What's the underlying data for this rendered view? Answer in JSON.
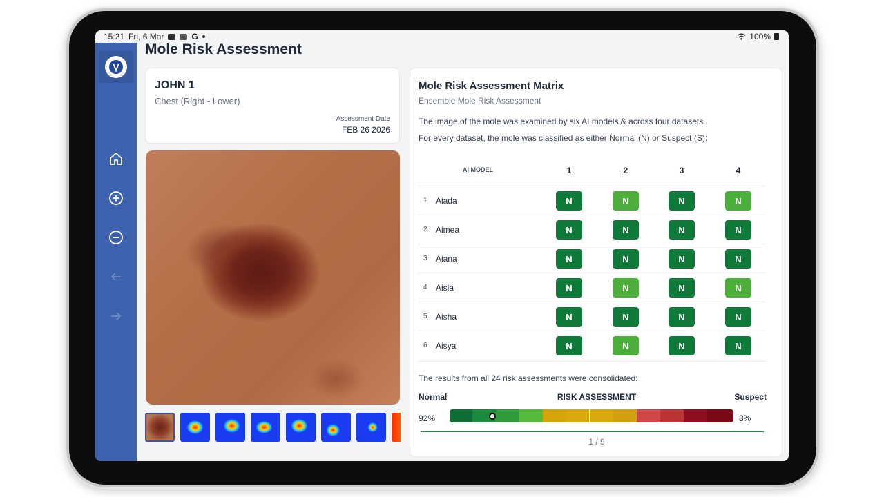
{
  "status": {
    "time": "15:21",
    "date": "Fri, 6 Mar",
    "battery": "100%"
  },
  "page": {
    "title": "Mole Risk Assessment"
  },
  "patient": {
    "name": "JOHN 1",
    "location": "Chest (Right - Lower)",
    "date_label": "Assessment Date",
    "date": "FEB 26 2026"
  },
  "matrix": {
    "title": "Mole Risk Assessment Matrix",
    "subtitle": "Ensemble Mole Risk Assessment",
    "desc1": "The image of the mole was examined by six AI models & across four datasets.",
    "desc2": "For every dataset, the mole was classified as either Normal (N) or Suspect (S):",
    "model_header": "AI MODEL",
    "columns": [
      "1",
      "2",
      "3",
      "4"
    ],
    "rows": [
      {
        "idx": "1",
        "model": "Aiada",
        "cells": [
          "N",
          "N",
          "N",
          "N"
        ],
        "shade": [
          "dark",
          "light",
          "dark",
          "light"
        ]
      },
      {
        "idx": "2",
        "model": "Aimea",
        "cells": [
          "N",
          "N",
          "N",
          "N"
        ],
        "shade": [
          "dark",
          "dark",
          "dark",
          "dark"
        ]
      },
      {
        "idx": "3",
        "model": "Aiana",
        "cells": [
          "N",
          "N",
          "N",
          "N"
        ],
        "shade": [
          "dark",
          "dark",
          "dark",
          "dark"
        ]
      },
      {
        "idx": "4",
        "model": "Aisla",
        "cells": [
          "N",
          "N",
          "N",
          "N"
        ],
        "shade": [
          "dark",
          "light",
          "dark",
          "light"
        ]
      },
      {
        "idx": "5",
        "model": "Aisha",
        "cells": [
          "N",
          "N",
          "N",
          "N"
        ],
        "shade": [
          "dark",
          "dark",
          "dark",
          "dark"
        ]
      },
      {
        "idx": "6",
        "model": "Aisya",
        "cells": [
          "N",
          "N",
          "N",
          "N"
        ],
        "shade": [
          "dark",
          "light",
          "dark",
          "dark"
        ]
      }
    ],
    "consolidated": "The results from all 24 risk assessments were consolidated:",
    "scale_left": "Normal",
    "scale_center": "RISK ASSESSMENT",
    "scale_right": "Suspect",
    "normal_pct": "92%",
    "suspect_pct": "8%",
    "marker_fraction": 0.15,
    "pager": "1 / 9"
  },
  "colors": {
    "sidebar": "#3d63ae",
    "badge_dark": "#0f7a3a",
    "badge_light": "#4caf3c"
  }
}
